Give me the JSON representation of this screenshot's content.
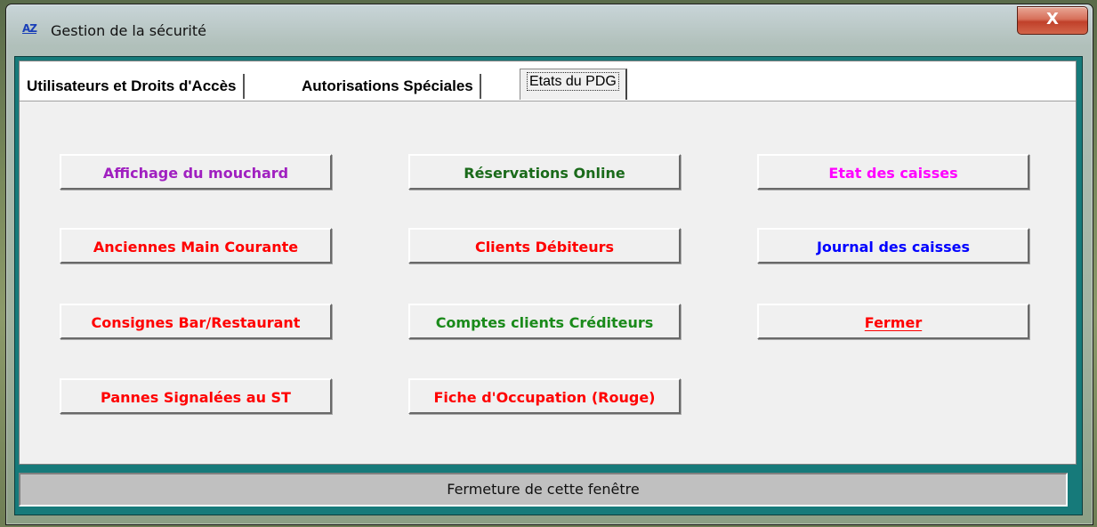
{
  "window": {
    "title": "Gestion de la sécurité",
    "icon": "AZ",
    "close_label": "X"
  },
  "tabs": [
    {
      "label": "Utilisateurs et Droits d'Accès",
      "active": false
    },
    {
      "label": "Autorisations Spéciales",
      "active": false
    },
    {
      "label": "Etats du PDG",
      "active": true
    }
  ],
  "buttons": {
    "col1": [
      {
        "label": "Affichage du mouchard",
        "color": "#a020c0"
      },
      {
        "label": "Anciennes Main Courante",
        "color": "#ff0000"
      },
      {
        "label": "Consignes Bar/Restaurant",
        "color": "#ff0000"
      },
      {
        "label": "Pannes Signalées au ST",
        "color": "#ff0000"
      }
    ],
    "col2": [
      {
        "label": "Réservations Online",
        "color": "#1a6a1a"
      },
      {
        "label": "Clients Débiteurs",
        "color": "#ff0000"
      },
      {
        "label": "Comptes clients Créditeurs",
        "color": "#1a8a1a"
      },
      {
        "label": "Fiche d'Occupation (Rouge)",
        "color": "#ff0000"
      }
    ],
    "col3": [
      {
        "label": "Etat des caisses",
        "color": "#ff00ff"
      },
      {
        "label": "Journal des caisses",
        "color": "#0000ff"
      },
      {
        "label": "Fermer",
        "color": "#ff0000",
        "mnemonic": "F"
      }
    ]
  },
  "status": {
    "text": "Fermeture de cette fenêtre"
  }
}
